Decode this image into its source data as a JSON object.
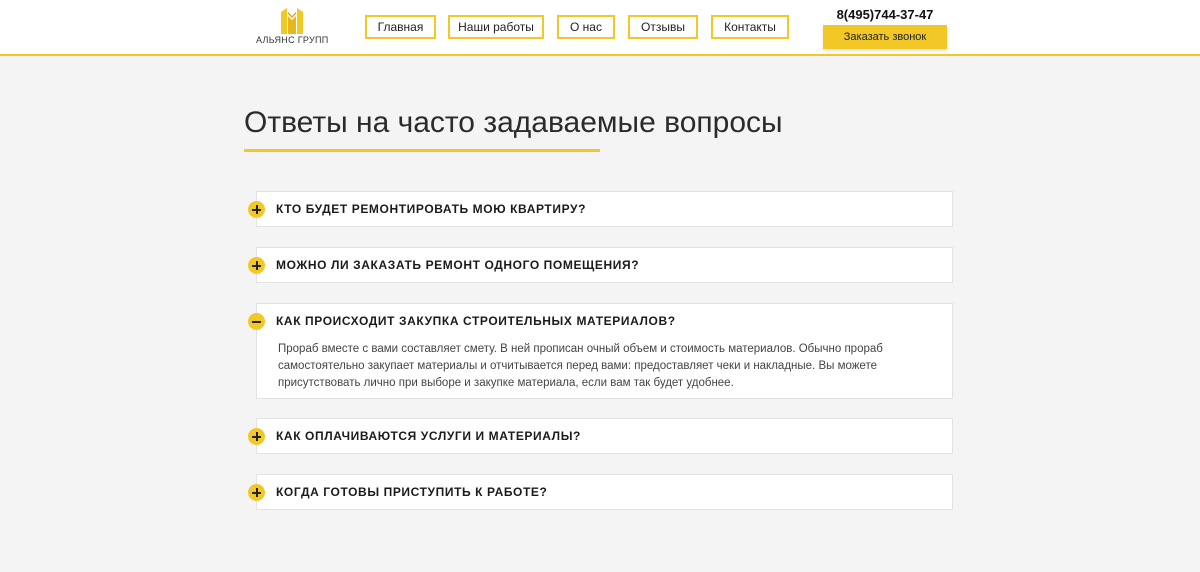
{
  "header": {
    "logo_text": "АЛЬЯНС ГРУПП",
    "nav": [
      {
        "label": "Главная"
      },
      {
        "label": "Наши работы"
      },
      {
        "label": "О нас"
      },
      {
        "label": "Отзывы"
      },
      {
        "label": "Контакты"
      }
    ],
    "phone": "8(495)744-37-47",
    "callback_label": "Заказать звонок"
  },
  "page": {
    "title": "Ответы на часто задаваемые вопросы"
  },
  "faq": [
    {
      "question": "Кто будет ремонтировать мою квартиру?",
      "expanded": false,
      "answer": ""
    },
    {
      "question": "Можно ли заказать ремонт одного помещения?",
      "expanded": false,
      "answer": ""
    },
    {
      "question": "Как происходит закупка строительных материалов?",
      "expanded": true,
      "answer": "Прораб вместе с вами составляет смету. В ней прописан очный объем и стоимость материалов. Обычно прораб самостоятельно закупает материалы и отчитывается перед вами: предоставляет чеки и накладные. Вы можете присутствовать лично при выборе и закупке материала, если вам так будет удобнее."
    },
    {
      "question": "Как оплачиваются услуги и материалы?",
      "expanded": false,
      "answer": ""
    },
    {
      "question": "Когда готовы приступить к работе?",
      "expanded": false,
      "answer": ""
    }
  ],
  "colors": {
    "accent": "#f2c827",
    "background": "#f4f4f4"
  }
}
